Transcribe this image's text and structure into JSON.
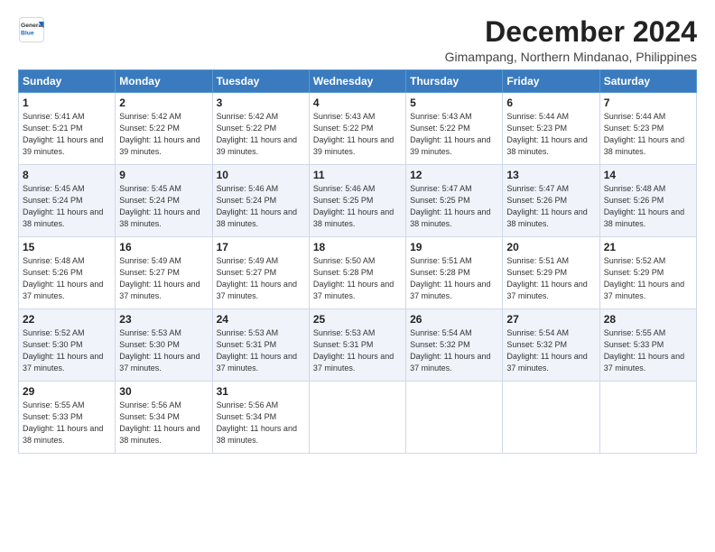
{
  "logo": {
    "general": "General",
    "blue": "Blue"
  },
  "header": {
    "title": "December 2024",
    "location": "Gimampang, Northern Mindanao, Philippines"
  },
  "days_of_week": [
    "Sunday",
    "Monday",
    "Tuesday",
    "Wednesday",
    "Thursday",
    "Friday",
    "Saturday"
  ],
  "weeks": [
    [
      {
        "day": "1",
        "sunrise": "5:41 AM",
        "sunset": "5:21 PM",
        "daylight": "11 hours and 39 minutes."
      },
      {
        "day": "2",
        "sunrise": "5:42 AM",
        "sunset": "5:22 PM",
        "daylight": "11 hours and 39 minutes."
      },
      {
        "day": "3",
        "sunrise": "5:42 AM",
        "sunset": "5:22 PM",
        "daylight": "11 hours and 39 minutes."
      },
      {
        "day": "4",
        "sunrise": "5:43 AM",
        "sunset": "5:22 PM",
        "daylight": "11 hours and 39 minutes."
      },
      {
        "day": "5",
        "sunrise": "5:43 AM",
        "sunset": "5:22 PM",
        "daylight": "11 hours and 39 minutes."
      },
      {
        "day": "6",
        "sunrise": "5:44 AM",
        "sunset": "5:23 PM",
        "daylight": "11 hours and 38 minutes."
      },
      {
        "day": "7",
        "sunrise": "5:44 AM",
        "sunset": "5:23 PM",
        "daylight": "11 hours and 38 minutes."
      }
    ],
    [
      {
        "day": "8",
        "sunrise": "5:45 AM",
        "sunset": "5:24 PM",
        "daylight": "11 hours and 38 minutes."
      },
      {
        "day": "9",
        "sunrise": "5:45 AM",
        "sunset": "5:24 PM",
        "daylight": "11 hours and 38 minutes."
      },
      {
        "day": "10",
        "sunrise": "5:46 AM",
        "sunset": "5:24 PM",
        "daylight": "11 hours and 38 minutes."
      },
      {
        "day": "11",
        "sunrise": "5:46 AM",
        "sunset": "5:25 PM",
        "daylight": "11 hours and 38 minutes."
      },
      {
        "day": "12",
        "sunrise": "5:47 AM",
        "sunset": "5:25 PM",
        "daylight": "11 hours and 38 minutes."
      },
      {
        "day": "13",
        "sunrise": "5:47 AM",
        "sunset": "5:26 PM",
        "daylight": "11 hours and 38 minutes."
      },
      {
        "day": "14",
        "sunrise": "5:48 AM",
        "sunset": "5:26 PM",
        "daylight": "11 hours and 38 minutes."
      }
    ],
    [
      {
        "day": "15",
        "sunrise": "5:48 AM",
        "sunset": "5:26 PM",
        "daylight": "11 hours and 37 minutes."
      },
      {
        "day": "16",
        "sunrise": "5:49 AM",
        "sunset": "5:27 PM",
        "daylight": "11 hours and 37 minutes."
      },
      {
        "day": "17",
        "sunrise": "5:49 AM",
        "sunset": "5:27 PM",
        "daylight": "11 hours and 37 minutes."
      },
      {
        "day": "18",
        "sunrise": "5:50 AM",
        "sunset": "5:28 PM",
        "daylight": "11 hours and 37 minutes."
      },
      {
        "day": "19",
        "sunrise": "5:51 AM",
        "sunset": "5:28 PM",
        "daylight": "11 hours and 37 minutes."
      },
      {
        "day": "20",
        "sunrise": "5:51 AM",
        "sunset": "5:29 PM",
        "daylight": "11 hours and 37 minutes."
      },
      {
        "day": "21",
        "sunrise": "5:52 AM",
        "sunset": "5:29 PM",
        "daylight": "11 hours and 37 minutes."
      }
    ],
    [
      {
        "day": "22",
        "sunrise": "5:52 AM",
        "sunset": "5:30 PM",
        "daylight": "11 hours and 37 minutes."
      },
      {
        "day": "23",
        "sunrise": "5:53 AM",
        "sunset": "5:30 PM",
        "daylight": "11 hours and 37 minutes."
      },
      {
        "day": "24",
        "sunrise": "5:53 AM",
        "sunset": "5:31 PM",
        "daylight": "11 hours and 37 minutes."
      },
      {
        "day": "25",
        "sunrise": "5:53 AM",
        "sunset": "5:31 PM",
        "daylight": "11 hours and 37 minutes."
      },
      {
        "day": "26",
        "sunrise": "5:54 AM",
        "sunset": "5:32 PM",
        "daylight": "11 hours and 37 minutes."
      },
      {
        "day": "27",
        "sunrise": "5:54 AM",
        "sunset": "5:32 PM",
        "daylight": "11 hours and 37 minutes."
      },
      {
        "day": "28",
        "sunrise": "5:55 AM",
        "sunset": "5:33 PM",
        "daylight": "11 hours and 37 minutes."
      }
    ],
    [
      {
        "day": "29",
        "sunrise": "5:55 AM",
        "sunset": "5:33 PM",
        "daylight": "11 hours and 38 minutes."
      },
      {
        "day": "30",
        "sunrise": "5:56 AM",
        "sunset": "5:34 PM",
        "daylight": "11 hours and 38 minutes."
      },
      {
        "day": "31",
        "sunrise": "5:56 AM",
        "sunset": "5:34 PM",
        "daylight": "11 hours and 38 minutes."
      },
      null,
      null,
      null,
      null
    ]
  ]
}
